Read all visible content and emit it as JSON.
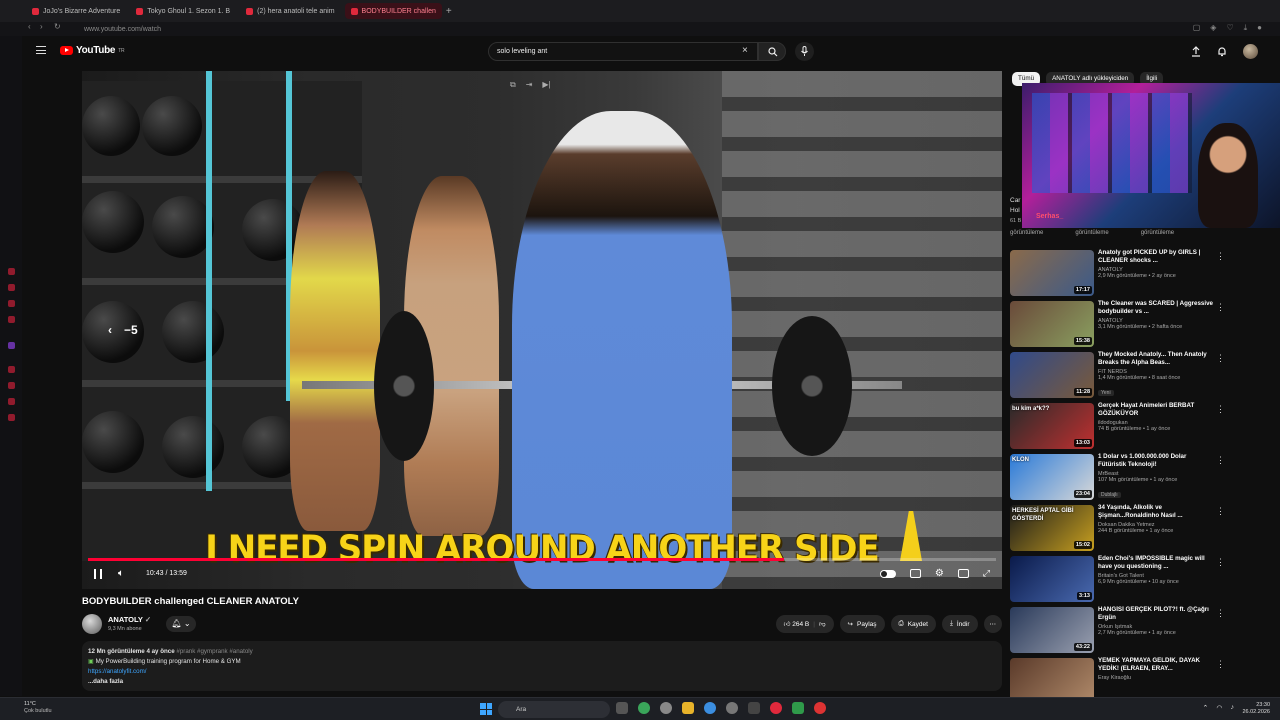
{
  "browser": {
    "tabs": [
      {
        "label": "JoJo's Bizarre Adventure"
      },
      {
        "label": "Tokyo Ghoul 1. Sezon 1. B"
      },
      {
        "label": "(2) hera anatoli tele anim"
      },
      {
        "label": "BODYBUILDER challen"
      }
    ],
    "new_tab": "+",
    "address": "www.youtube.com/watch"
  },
  "header": {
    "logo_text": "YouTube",
    "logo_region": "TR",
    "search_value": "solo leveling ant",
    "clear_icon": "×"
  },
  "player": {
    "caption": "I NEED SPIN AROUND ANOTHER SIDE",
    "seek_label": "5",
    "time": "10:43 / 13:59",
    "progress": 0.766,
    "accent": "#ff0033"
  },
  "video": {
    "title": "BODYBUILDER challenged CLEANER ANATOLY",
    "channel": "ANATOLY",
    "subscribers": "9,3 Mn abone",
    "likes": "264 B",
    "share": "Paylaş",
    "save": "Kaydet",
    "download": "İndir",
    "description": {
      "meta": "12 Mn görüntüleme  4 ay önce",
      "tags": "#prank #gymprank #anatoly",
      "line1": "My PowerBuilding training program for Home & GYM",
      "link": "https://anatolyfit.com/",
      "more": "...daha fazla"
    }
  },
  "right": {
    "chips": [
      {
        "label": "Tümü"
      },
      {
        "label": "ANATOLY adlı yükleyiciden"
      },
      {
        "label": "İlgili"
      }
    ],
    "webcam_overlay": "Serhas_",
    "partial_title_1": "Car",
    "partial_title_2": "Hol",
    "partial_views": "61 B",
    "views_row": [
      "görüntüleme",
      "görüntüleme",
      "görüntüleme"
    ],
    "recommendations": [
      {
        "title": "Anatoly got PICKED UP by GIRLS | CLEANER shocks ...",
        "channel": "ANATOLY",
        "meta": "2,9 Mn görüntüleme • 2 ay önce",
        "duration": "17:17",
        "c1": "#8a6a4a",
        "c2": "#3b5a8a",
        "thumb_text": ""
      },
      {
        "title": "The Cleaner was SCARED | Aggressive bodybuilder vs ...",
        "channel": "ANATOLY",
        "meta": "3,1 Mn görüntüleme • 2 hafta önce",
        "duration": "15:38",
        "c1": "#6a4a3a",
        "c2": "#8aa060",
        "thumb_text": ""
      },
      {
        "title": "They Mocked Anatoly... Then Anatoly Breaks the Alpha Beas...",
        "channel": "FIT NERDS",
        "meta": "1,4 Mn görüntüleme • 8 saat önce",
        "duration": "11:28",
        "c1": "#304a8a",
        "c2": "#7a5a3a",
        "thumb_text": "",
        "badge": "Yeni"
      },
      {
        "title": "Gerçek Hayat Animeleri BERBAT GÖZÜKÜYOR",
        "channel": "ildodogukan",
        "meta": "74 B görüntüleme • 1 ay önce",
        "duration": "13:03",
        "c1": "#2a2a2a",
        "c2": "#c03030",
        "thumb_text": "bu kim a*k??"
      },
      {
        "title": "1 Dolar vs 1.000.000.000 Dolar Fütüristik Teknoloji!",
        "channel": "MrBeast",
        "meta": "107 Mn görüntüleme • 1 ay önce",
        "duration": "23:04",
        "c1": "#2a7ad8",
        "c2": "#d8d8d8",
        "thumb_text": "KLON",
        "badge": "Dublajlı"
      },
      {
        "title": "34 Yaşında, Alkolik ve Şişman...Ronaldinho Nasıl ...",
        "channel": "Doksan Dakika Yetmez",
        "meta": "244 B görüntüleme • 1 ay önce",
        "duration": "15:02",
        "c1": "#1a1a1a",
        "c2": "#c8a020",
        "thumb_text": "HERKESİ APTAL GİBİ GÖSTERDİ"
      },
      {
        "title": "Eden Choi's IMPOSSIBLE magic will have you questioning ...",
        "channel": "Britain's Got Talent",
        "meta": "6,9 Mn görüntüleme • 10 ay önce",
        "duration": "3:13",
        "c1": "#0a1a4a",
        "c2": "#4a6ab0",
        "thumb_text": ""
      },
      {
        "title": "HANGİSİ GERÇEK PİLOT?! ft. @Çağrı Ergün",
        "channel": "Orkun Işıtmak",
        "meta": "2,7 Mn görüntüleme • 1 ay önce",
        "duration": "43:22",
        "c1": "#2a3a5a",
        "c2": "#9aa0b0",
        "thumb_text": ""
      },
      {
        "title": "YEMEK YAPMAYA GELDİK, DAYAK YEDİK! (ELRAEN, ERAY...",
        "channel": "Eray Kiraoğlu",
        "meta": "",
        "duration": "",
        "c1": "#5a3a2a",
        "c2": "#b08a6a",
        "thumb_text": ""
      }
    ]
  },
  "taskbar": {
    "temp": "11°C",
    "weather": "Çok bulutlu",
    "search": "Ara",
    "time": "23:30",
    "date": "26.02.2026"
  }
}
